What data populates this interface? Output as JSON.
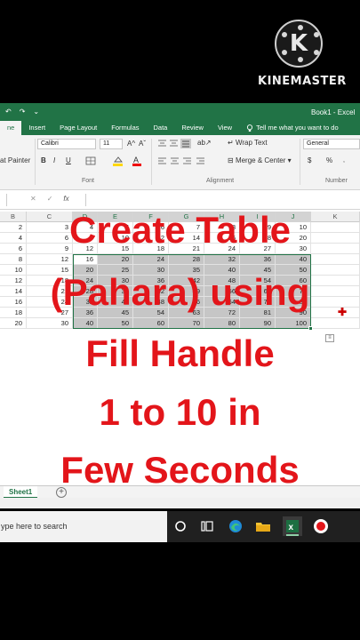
{
  "watermark": {
    "brand": "KINEMASTER",
    "logo_letter": "K"
  },
  "excel": {
    "titlebar": {
      "undo": "↶",
      "redo": "↷",
      "qa_more": "⌄",
      "book_title": "Book1 - Excel"
    },
    "tabs": [
      "ne",
      "Insert",
      "Page Layout",
      "Formulas",
      "Data",
      "Review",
      "View"
    ],
    "tell_me": "Tell me what you want to do",
    "ribbon": {
      "format_painter": "at Painter",
      "font_name": "Calibri",
      "font_size": "11",
      "grow": "A^",
      "shrink": "Aˇ",
      "bold": "B",
      "italic": "I",
      "underline": "U",
      "wrap_text": "Wrap Text",
      "merge_center": "Merge & Center",
      "number_format": "General",
      "currency": "$",
      "percent": "%",
      "group_font": "Font",
      "group_alignment": "Alignment",
      "group_number": "Number"
    },
    "formulabar": {
      "cancel": "✕",
      "enter": "✓",
      "fx": "fx"
    },
    "columns": [
      "B",
      "C",
      "D",
      "E",
      "F",
      "G",
      "H",
      "I",
      "J",
      "K"
    ],
    "rows": [
      [
        "2",
        "3",
        "4",
        "5",
        "6",
        "7",
        "8",
        "9",
        "10"
      ],
      [
        "4",
        "6",
        "8",
        "10",
        "12",
        "14",
        "16",
        "18",
        "20"
      ],
      [
        "6",
        "9",
        "12",
        "15",
        "18",
        "21",
        "24",
        "27",
        "30"
      ],
      [
        "8",
        "12",
        "16",
        "20",
        "24",
        "28",
        "32",
        "36",
        "40"
      ],
      [
        "10",
        "15",
        "20",
        "25",
        "30",
        "35",
        "40",
        "45",
        "50"
      ],
      [
        "12",
        "18",
        "24",
        "30",
        "36",
        "42",
        "48",
        "54",
        "60"
      ],
      [
        "14",
        "21",
        "28",
        "35",
        "42",
        "49",
        "56",
        "63",
        "70"
      ],
      [
        "16",
        "24",
        "32",
        "40",
        "48",
        "56",
        "64",
        "72",
        "80"
      ],
      [
        "18",
        "27",
        "36",
        "45",
        "54",
        "63",
        "72",
        "81",
        "90"
      ],
      [
        "20",
        "30",
        "40",
        "50",
        "60",
        "70",
        "80",
        "90",
        "100"
      ]
    ],
    "sheet_tab": "Sheet1",
    "add_sheet": "+"
  },
  "taskbar": {
    "search_placeholder": "ype here to search"
  },
  "caption": {
    "line1": "Create Table",
    "line2": "(Pahara) using",
    "line3": "Fill Handle",
    "line4": "1 to 10 in",
    "line5": "Few Seconds",
    "color": "#e3151a"
  }
}
